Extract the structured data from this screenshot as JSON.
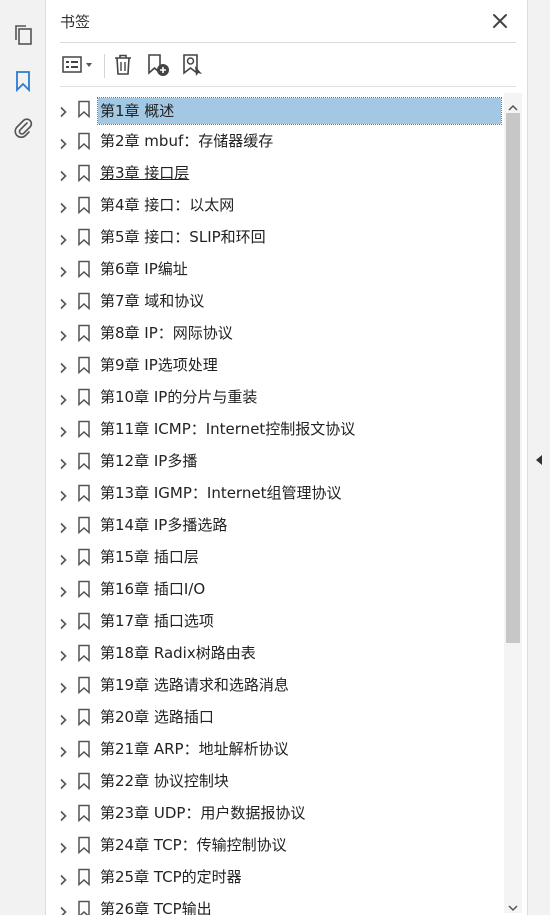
{
  "panel": {
    "title": "书签"
  },
  "icons": {
    "pages": "pages-icon",
    "bookmarks": "bookmark-panel-icon",
    "attachments": "paperclip-icon",
    "close": "close-icon",
    "options": "options-menu-icon",
    "delete": "trash-icon",
    "new_bookmark": "new-bookmark-icon",
    "bookmark_from_selection": "bookmark-search-icon",
    "expand": "chevron-right-icon",
    "bookmark_item": "bookmark-icon"
  },
  "colors": {
    "selection": "#a3c8e4",
    "accent": "#2d7bd3"
  },
  "bookmarks": [
    {
      "label": "第1章 概述"
    },
    {
      "label": "第2章 mbuf：存储器缓存"
    },
    {
      "label": "第3章 接口层"
    },
    {
      "label": "第4章 接口：以太网"
    },
    {
      "label": "第5章 接口：SLIP和环回"
    },
    {
      "label": "第6章 IP编址"
    },
    {
      "label": "第7章 域和协议"
    },
    {
      "label": "第8章 IP：网际协议"
    },
    {
      "label": "第9章 IP选项处理"
    },
    {
      "label": "第10章 IP的分片与重装"
    },
    {
      "label": "第11章 ICMP：Internet控制报文协议"
    },
    {
      "label": "第12章 IP多播"
    },
    {
      "label": "第13章 IGMP：Internet组管理协议"
    },
    {
      "label": "第14章 IP多播选路"
    },
    {
      "label": "第15章 插口层"
    },
    {
      "label": "第16章 插口I/O"
    },
    {
      "label": "第17章 插口选项"
    },
    {
      "label": "第18章 Radix树路由表"
    },
    {
      "label": "第19章 选路请求和选路消息"
    },
    {
      "label": "第20章 选路插口"
    },
    {
      "label": "第21章 ARP：地址解析协议"
    },
    {
      "label": "第22章 协议控制块"
    },
    {
      "label": "第23章 UDP：用户数据报协议"
    },
    {
      "label": "第24章 TCP：传输控制协议"
    },
    {
      "label": "第25章 TCP的定时器"
    },
    {
      "label": "第26章 TCP输出"
    }
  ]
}
